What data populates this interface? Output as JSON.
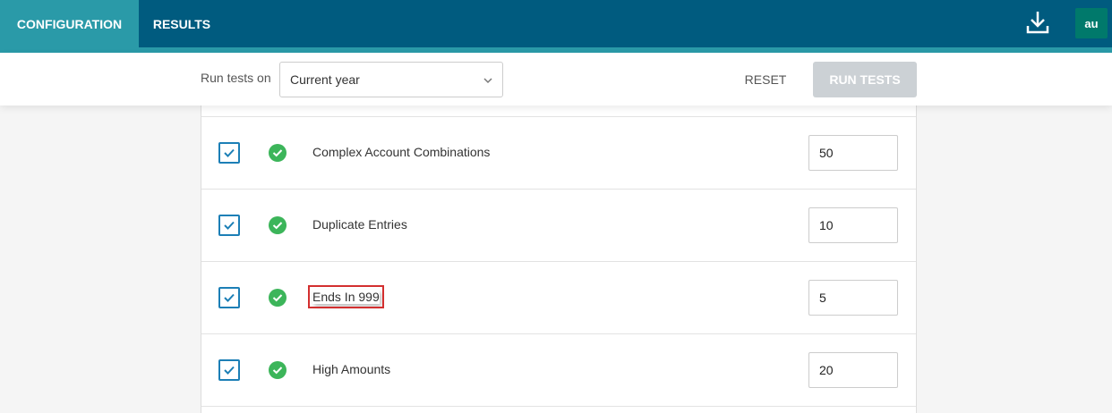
{
  "nav": {
    "tabs": [
      {
        "label": "CONFIGURATION",
        "active": true
      },
      {
        "label": "RESULTS",
        "active": false
      }
    ],
    "download_icon": "download-icon",
    "avatar_initials": "au",
    "colors": {
      "nav_bg": "#005b7f",
      "active_tab": "#2a9aa8",
      "avatar": "#00796b"
    }
  },
  "toolbar": {
    "run_tests_on_label": "Run tests on",
    "period_select_value": "Current year",
    "reset_label": "RESET",
    "run_tests_label": "RUN TESTS"
  },
  "tests": [
    {
      "name": "Complex Account Combinations",
      "checked": true,
      "status": "check-circle-icon",
      "value": "50",
      "highlighted": false
    },
    {
      "name": "Duplicate Entries",
      "checked": true,
      "status": "check-circle-icon",
      "value": "10",
      "highlighted": false
    },
    {
      "name": "Ends In 999",
      "checked": true,
      "status": "check-circle-icon",
      "value": "5",
      "highlighted": true
    },
    {
      "name": "High Amounts",
      "checked": true,
      "status": "check-circle-icon",
      "value": "20",
      "highlighted": false
    }
  ],
  "colors": {
    "checkbox": "#1c7fb6",
    "status_ok": "#3cb55a",
    "highlight": "#d32f2f"
  }
}
